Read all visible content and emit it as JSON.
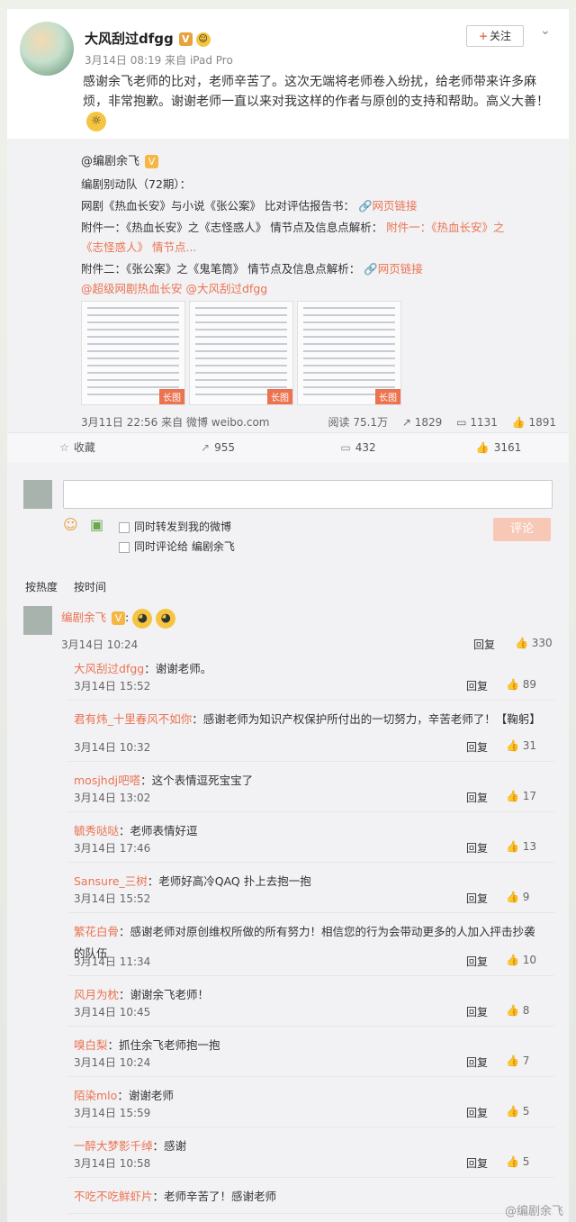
{
  "post": {
    "author": "大风刮过dfgg",
    "follow": "关注",
    "time": "3月14日 08:19",
    "source": "来自 iPad Pro",
    "text": "感谢余飞老师的比对，老师辛苦了。这次无端将老师卷入纷扰，给老师带来许多麻烦，非常抱歉。谢谢老师一直以来对我这样的作者与原创的支持和帮助。高义大善！"
  },
  "repost": {
    "author": "@编剧余飞",
    "line1": "编剧别动队（72期）：",
    "line2_text": "网剧《热血长安》与小说《张公案》 比对评估报告书：",
    "link_label": "网页链接",
    "line3_text": "附件一：《热血长安》之《志怪惑人》 情节点及信息点解析：",
    "line3_link": "附件一：《热血长安》之",
    "line4_link": "《志怪惑人》 情节点...",
    "line5_text": "附件二：《张公案》之《鬼笔筒》 情节点及信息点解析：",
    "mention1": "@超级网剧热血长安",
    "mention2": "@大风刮过dfgg",
    "long_img": "长图",
    "time": "3月11日 22:56",
    "source": "来自 微博 weibo.com",
    "reads": "阅读 75.1万",
    "reposts": "1829",
    "comments": "1131",
    "likes": "1891"
  },
  "actions": {
    "favorite": "收藏",
    "repost": "955",
    "comment": "432",
    "like": "3161"
  },
  "comment_box": {
    "opt1": "同时转发到我的微博",
    "opt2": "同时评论给 编剧余飞",
    "submit": "评论"
  },
  "sort": {
    "hot": "按热度",
    "time": "按时间"
  },
  "top_comment": {
    "name": "编剧余飞",
    "time": "3月14日 10:24",
    "reply": "回复",
    "likes": "330"
  },
  "replies": [
    {
      "name": "大风刮过dfgg",
      "text": "：谢谢老师。",
      "time": "3月14日 15:52",
      "likes": "89"
    },
    {
      "name": "君有炜_十里春风不如你",
      "text": "：感谢老师为知识产权保护所付出的一切努力，辛苦老师了！【鞠躬】",
      "time": "3月14日 10:32",
      "likes": "31"
    },
    {
      "name": "mosjhdj吧嗒",
      "text": "：这个表情逗死宝宝了",
      "time": "3月14日 13:02",
      "likes": "17"
    },
    {
      "name": "毓秀哒哒",
      "text": "：老师表情好逗",
      "time": "3月14日 17:46",
      "likes": "13"
    },
    {
      "name": "Sansure_三树",
      "text": "：老师好高冷QAQ 扑上去抱一抱",
      "time": "3月14日 15:52",
      "likes": "9"
    },
    {
      "name": "繁花白骨",
      "text": "：感谢老师对原创维权所做的所有努力！相信您的行为会带动更多的人加入抨击抄袭的队伍",
      "time": "3月14日 11:34",
      "likes": "10"
    },
    {
      "name": "风月为枕",
      "text": "：谢谢余飞老师！",
      "time": "3月14日 10:45",
      "likes": "8"
    },
    {
      "name": "嗅白梨",
      "text": "：抓住余飞老师抱一抱",
      "time": "3月14日 10:24",
      "likes": "7"
    },
    {
      "name": "陌染mlo",
      "text": "：谢谢老师",
      "time": "3月14日 15:59",
      "likes": "5"
    },
    {
      "name": "一醉大梦影千绰",
      "text": "：感谢",
      "time": "3月14日 10:58",
      "likes": "5"
    },
    {
      "name": "不吃不吃鲜虾片",
      "text": "：老师辛苦了！感谢老师",
      "time": "",
      "likes": ""
    }
  ],
  "reply_label": "回复",
  "watermark": "@编剧余飞"
}
